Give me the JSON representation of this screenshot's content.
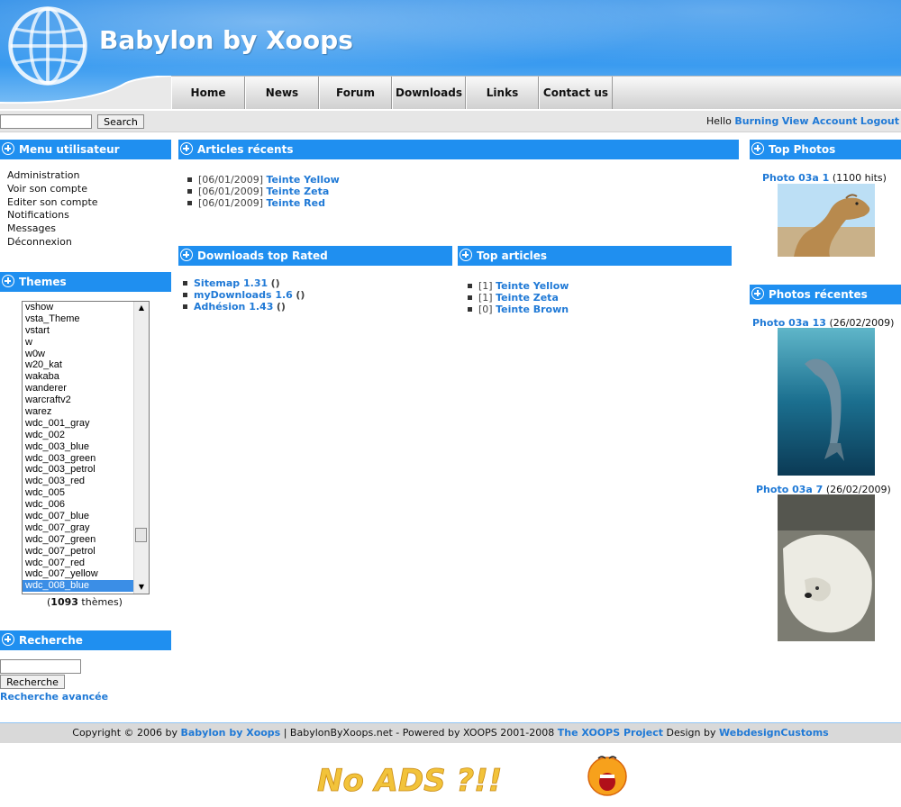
{
  "header": {
    "site_title": "Babylon by Xoops",
    "nav": [
      "Home",
      "News",
      "Forum",
      "Downloads",
      "Links",
      "Contact us"
    ]
  },
  "topbar": {
    "search_button": "Search",
    "hello_prefix": "Hello",
    "username": "Burning",
    "view_account": "View Account",
    "logout": "Logout"
  },
  "user_menu": {
    "title": "Menu utilisateur",
    "items": [
      "Administration",
      "Voir son compte",
      "Editer son compte",
      "Notifications",
      "Messages",
      "Déconnexion"
    ]
  },
  "themes": {
    "title": "Themes",
    "options": [
      "vshow",
      "vsta_Theme",
      "vstart",
      "w",
      "w0w",
      "w20_kat",
      "wakaba",
      "wanderer",
      "warcraftv2",
      "warez",
      "wdc_001_gray",
      "wdc_002",
      "wdc_003_blue",
      "wdc_003_green",
      "wdc_003_petrol",
      "wdc_003_red",
      "wdc_005",
      "wdc_006",
      "wdc_007_blue",
      "wdc_007_gray",
      "wdc_007_green",
      "wdc_007_petrol",
      "wdc_007_red",
      "wdc_007_yellow",
      "wdc_008_blue"
    ],
    "selected": "wdc_008_blue",
    "count_open": "(",
    "count": "1093",
    "count_label": " thèmes)"
  },
  "search": {
    "title": "Recherche",
    "button": "Recherche",
    "advanced": "Recherche avancée"
  },
  "recent_articles": {
    "title": "Articles récents",
    "items": [
      {
        "date": "[06/01/2009]",
        "title": "Teinte Yellow"
      },
      {
        "date": "[06/01/2009]",
        "title": "Teinte Zeta"
      },
      {
        "date": "[06/01/2009]",
        "title": "Teinte Red"
      }
    ]
  },
  "downloads_top": {
    "title": "Downloads top Rated",
    "items": [
      {
        "title": "Sitemap 1.31",
        "extra": "()"
      },
      {
        "title": "myDownloads 1.6",
        "extra": "()"
      },
      {
        "title": "Adhésion 1.43",
        "extra": "()"
      }
    ]
  },
  "top_articles": {
    "title": "Top articles",
    "items": [
      {
        "count": "[1]",
        "title": "Teinte Yellow"
      },
      {
        "count": "[1]",
        "title": "Teinte Zeta"
      },
      {
        "count": "[0]",
        "title": "Teinte Brown"
      }
    ]
  },
  "top_photos": {
    "title": "Top Photos",
    "items": [
      {
        "title": "Photo 03a 1",
        "meta": "(1100 hits)"
      }
    ]
  },
  "recent_photos": {
    "title": "Photos récentes",
    "items": [
      {
        "title": "Photo 03a 13",
        "meta": "(26/02/2009)"
      },
      {
        "title": "Photo 03a 7",
        "meta": "(26/02/2009)"
      }
    ]
  },
  "footer": {
    "copyright": "Copyright © 2006 by",
    "site_link": "Babylon by Xoops",
    "middle": "| BabylonByXoops.net - Powered by XOOPS 2001-2008",
    "xoops_link": "The XOOPS Project",
    "design_by": "Design by",
    "designer_link": "WebdesignCustoms"
  },
  "no_ads": "No ADS ?!!",
  "colors": {
    "accent": "#1f8ff0",
    "link": "#1f79d6",
    "header_blue": "#2e8ee8"
  }
}
